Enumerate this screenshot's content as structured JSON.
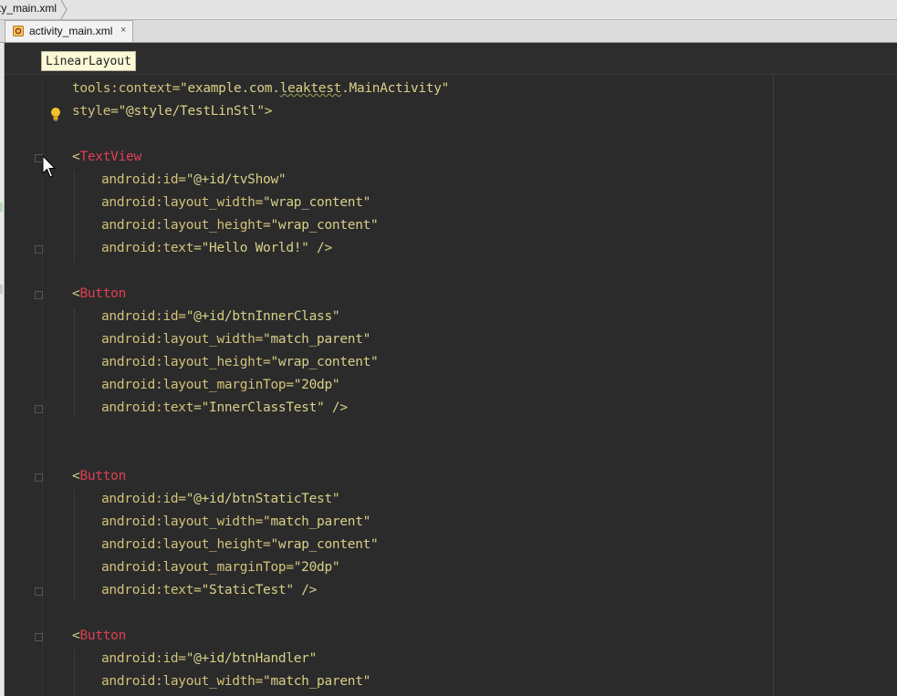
{
  "breadcrumb": {
    "file": "ty_main.xml"
  },
  "tab": {
    "label": "activity_main.xml",
    "close": "×"
  },
  "tooltip": {
    "text": "LinearLayout"
  },
  "code": {
    "l1_attr": "tools:context=",
    "l1_val_a": "\"example.com.",
    "l1_val_b": "leaktest",
    "l1_val_c": ".MainActivity\"",
    "l2_attr": "style=",
    "l2_val": "\"@style/TestLinStl\"",
    "l2_end": ">",
    "tv_open": "<",
    "tv_tag": "TextView",
    "tv_id_attr": "android:id=",
    "tv_id_val": "\"@+id/tvShow\"",
    "tv_w_attr": "android:layout_width=",
    "tv_w_val": "\"wrap_content\"",
    "tv_h_attr": "android:layout_height=",
    "tv_h_val": "\"wrap_content\"",
    "tv_t_attr": "android:text=",
    "tv_t_val": "\"Hello World!\"",
    "tv_t_end": " />",
    "b1_open": "<",
    "b1_tag": "Button",
    "b1_id_attr": "android:id=",
    "b1_id_val": "\"@+id/btnInnerClass\"",
    "b1_w_attr": "android:layout_width=",
    "b1_w_val": "\"match_parent\"",
    "b1_h_attr": "android:layout_height=",
    "b1_h_val": "\"wrap_content\"",
    "b1_m_attr": "android:layout_marginTop=",
    "b1_m_val": "\"20dp\"",
    "b1_t_attr": "android:text=",
    "b1_t_val": "\"InnerClassTest\"",
    "b1_t_end": " />",
    "b2_open": "<",
    "b2_tag": "Button",
    "b2_id_attr": "android:id=",
    "b2_id_val": "\"@+id/btnStaticTest\"",
    "b2_w_attr": "android:layout_width=",
    "b2_w_val": "\"match_parent\"",
    "b2_h_attr": "android:layout_height=",
    "b2_h_val": "\"wrap_content\"",
    "b2_m_attr": "android:layout_marginTop=",
    "b2_m_val": "\"20dp\"",
    "b2_t_attr": "android:text=",
    "b2_t_val": "\"StaticTest\"",
    "b2_t_end": " />",
    "b3_open": "<",
    "b3_tag": "Button",
    "b3_id_attr": "android:id=",
    "b3_id_val": "\"@+id/btnHandler\"",
    "b3_w_attr": "android:layout_width=",
    "b3_w_val": "\"match_parent\""
  },
  "colors": {
    "editor_bg": "#2b2b2b",
    "attr": "#d0c27a",
    "value": "#d7d088",
    "tag": "#e03e52",
    "tooltip_bg": "#fcf9d6"
  }
}
